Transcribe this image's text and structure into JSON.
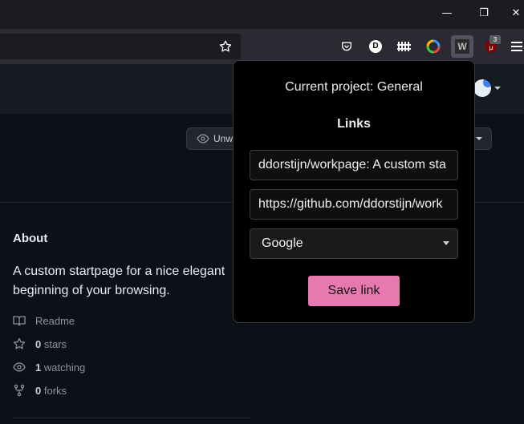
{
  "window": {
    "minimize_glyph": "—",
    "restore_glyph": "❐",
    "close_glyph": "✕"
  },
  "toolbar": {
    "icons": [
      "bookmark-star-icon",
      "pocket-icon",
      "extension-d-icon",
      "extension-grid-icon",
      "color-picker-icon",
      "workpage-extension-icon",
      "ublock-icon",
      "menu-icon"
    ],
    "ext_d_label": "D",
    "ext_w_label": "W",
    "ublock_badge": "3"
  },
  "repo": {
    "watch_button_label": "Unwa",
    "about_title": "About",
    "about_description": "A custom startpage for a nice elegant beginning of your browsing.",
    "meta": [
      {
        "icon": "book-icon",
        "count": "",
        "label": "Readme"
      },
      {
        "icon": "star-icon",
        "count": "0",
        "label": "stars"
      },
      {
        "icon": "eye-icon",
        "count": "1",
        "label": "watching"
      },
      {
        "icon": "fork-icon",
        "count": "0",
        "label": "forks"
      }
    ]
  },
  "popup": {
    "project_text": "Current project: General",
    "links_heading": "Links",
    "title_value": "ddorstijn/workpage: A custom sta",
    "url_value": "https://github.com/ddorstijn/work",
    "category_selected": "Google",
    "save_label": "Save link"
  },
  "colors": {
    "accent_pink": "#e879b0",
    "page_bg": "#0d1117",
    "popup_bg": "#000000"
  }
}
